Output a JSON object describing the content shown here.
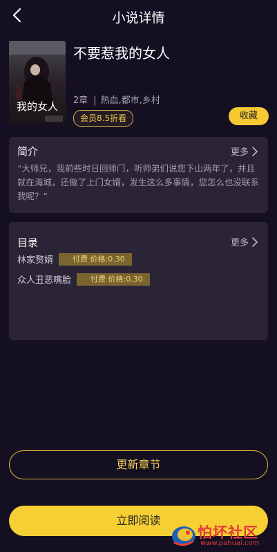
{
  "header": {
    "title": "小说详情"
  },
  "book": {
    "title": "不要惹我的女人",
    "chapters": "2章",
    "separator": "|",
    "tags": "热血,都市,乡村",
    "vip_discount": "会员8.5折看",
    "collect_label": "收藏",
    "cover_text": "我的女人"
  },
  "intro": {
    "heading": "简介",
    "more_label": "更多",
    "text": "“大师兄，我前些时日回师门，听师弟们说您下山两年了，并且就在海城，还做了上门女婿，发生这么多事情，您怎么也没联系我呢？”"
  },
  "toc": {
    "heading": "目录",
    "more_label": "更多",
    "chapters": [
      {
        "title": "林家赘婿",
        "price": "付费 价格:0.30"
      },
      {
        "title": "众人丑恶嘴脸",
        "price": "付费 价格:0.30"
      }
    ]
  },
  "actions": {
    "update_label": "更新章节",
    "read_label": "立即阅读"
  },
  "watermark": {
    "text": "怕坏社区",
    "url": "www.pahuai.com"
  },
  "colors": {
    "background": "#150f22",
    "card": "#2a2436",
    "accent": "#f6cf34",
    "price_bg": "#7a6530"
  }
}
